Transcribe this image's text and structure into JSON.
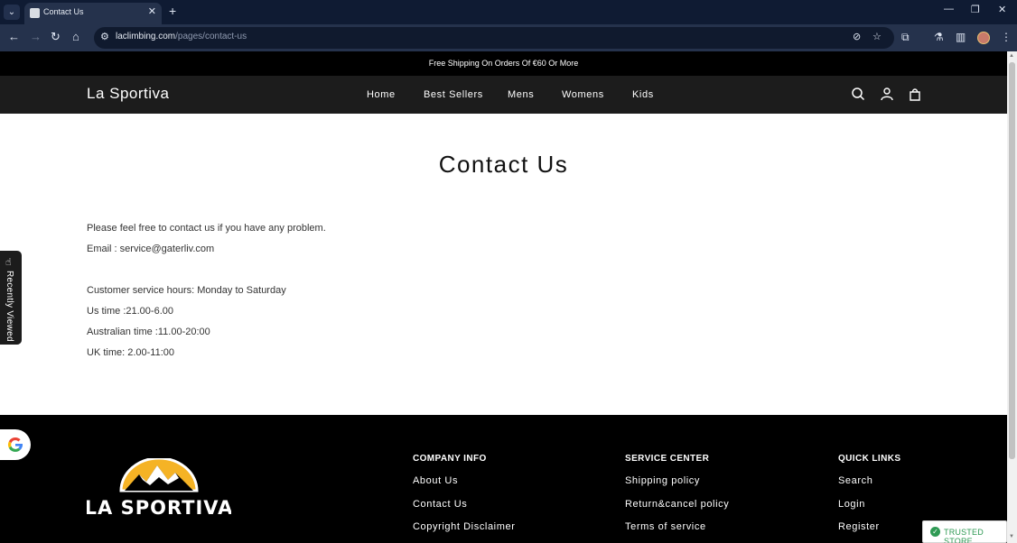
{
  "browser": {
    "tab_title": "Contact Us",
    "url_host": "laclimbing.com",
    "url_path": "/pages/contact-us"
  },
  "announcement": "Free Shipping On Orders Of €60 Or More",
  "header": {
    "logo": "La Sportiva",
    "nav": [
      "Home",
      "Best Sellers",
      "Mens",
      "Womens",
      "Kids"
    ]
  },
  "page": {
    "title": "Contact Us",
    "intro": "Please feel free to contact us if you have any problem.",
    "email": "Email : service@gaterliv.com",
    "hours": "Customer service hours: Monday to Saturday",
    "us_time": "Us time :21.00-6.00",
    "australian_time": "Australian time :11.00-20:00",
    "uk_time": "UK time: 2.00-11:00"
  },
  "recently_viewed": "Recently Viewed",
  "footer": {
    "logo_text": "LA SPORTIVA",
    "columns": [
      {
        "heading": "COMPANY INFO",
        "links": [
          "About Us",
          "Contact Us",
          "Copyright Disclaimer"
        ]
      },
      {
        "heading": "SERVICE CENTER",
        "links": [
          "Shipping policy",
          "Return&cancel policy",
          "Terms of service"
        ]
      },
      {
        "heading": "QUICK LINKS",
        "links": [
          "Search",
          "Login",
          "Register"
        ]
      }
    ]
  },
  "trusted_store": "TRUSTED STORE",
  "colors": {
    "browser_dark": "#0f1b33",
    "toolbar": "#25324c",
    "header_bg": "#1c1c1c",
    "footer_bg": "#000000",
    "logo_yellow": "#f5b325",
    "trusted_green": "#2f9a54"
  }
}
